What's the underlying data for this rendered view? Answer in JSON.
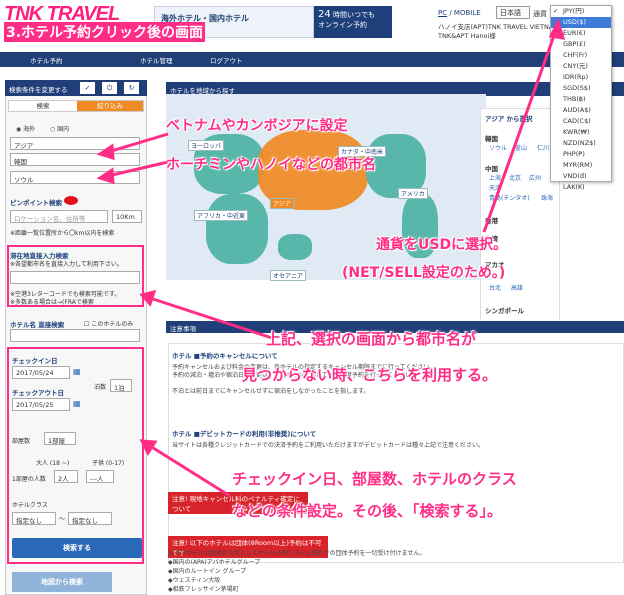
{
  "header": {
    "logo": "TNK TRAVEL",
    "banner_title": "海外ホテル・国内ホテル",
    "hours_big": "24",
    "hours_text": "時間いつでも",
    "hours_sub": "オンライン予約",
    "pc": "PC",
    "mobile": "MOBILE",
    "language": "日本語",
    "currency_label": "通貨",
    "address1": "ハノイ支店(APT)TNK TRAVEL VIETNAM",
    "address2": "TNK&APT Hanoi様"
  },
  "nav": [
    "ホテル予約",
    "ホテル管理",
    "ログアウト"
  ],
  "currency_menu": {
    "items": [
      "JPY(円)",
      "USD($)",
      "EUR(€)",
      "GBP(£)",
      "CHF(Fr)",
      "CNY(元)",
      "IDR(Rp)",
      "SGD(S$)",
      "THB(฿)",
      "AUD(A$)",
      "CAD(C$)",
      "KWR(₩)",
      "NZD(NZ$)",
      "PHP(₱)",
      "MYR(RM)",
      "VND(đ)",
      "LAK(₭)"
    ],
    "selected": "USD($)",
    "check": "✓"
  },
  "left": {
    "header": "検索条件を変更する",
    "tab_search": "検索",
    "tab_filter": "絞り込み",
    "radio_overseas": "海外",
    "radio_domestic": "国内",
    "region": "アジア",
    "country": "韓国",
    "city": "ソウル",
    "pinpoint": "ピンポイント検索",
    "location_placeholder": "ロケーション名、住所等",
    "distance": "10Km",
    "distance_note": "※距離一覧位置所から〇km以内を検索",
    "city_input_title": "滞在地直接入力検索",
    "city_input_note": "※各望都市名を直接入力して利用下さい。",
    "city_input_note2": "※空港3レターコードでも検索可能です。",
    "city_input_note3": "※多数ある場合は→(FRAで検索",
    "hotel_name_search": "ホテル名 直接検索",
    "hotel_only": "このホテルのみ",
    "checkin_label": "チェックイン日",
    "checkin": "2017/05/24",
    "checkout_label": "チェックアウト日",
    "checkout": "2017/05/25",
    "nights_label": "泊数",
    "nights": "1泊",
    "rooms_label": "部屋数",
    "rooms": "1部屋",
    "adults_label": "大人 (18 ~)",
    "children_label": "子供 (0-17)",
    "per_room": "1部屋の人数",
    "adults": "2人",
    "children": "---人",
    "class_label": "ホテルクラス",
    "class_from": "指定なし",
    "tilde": "〜",
    "class_to": "指定なし",
    "search_button": "検索する",
    "map_search": "地図から検索"
  },
  "map": {
    "header": "ホテルを地域から探す",
    "labels": [
      "ヨーロッパ",
      "カナダ・中南米",
      "アメリカ",
      "アフリカ・中近東",
      "アジア",
      "オセアニア"
    ],
    "right_header": "アジア から選択"
  },
  "asia_panel": {
    "items": [
      "韓国",
      "ソウル",
      "釜山",
      "仁川",
      "中国",
      "上海",
      "北京",
      "広州",
      "天津",
      "青島(チンタオ)",
      "珠海",
      "香港",
      "台湾",
      "マカオ",
      "台北",
      "高雄",
      "シンガポール"
    ]
  },
  "notices": {
    "header": "注意事項",
    "t1": "ホテル",
    "t1b": "■予約のキャンセルについて",
    "p1": "予約キャンセルおよび料金の変更は、各ホテルの指定するキャンセル期限までに行ってください。",
    "p2": "予約の減泊・増泊や宿泊日の変更は、一度キャンセルしてから再度予約を行ってください。",
    "p3": "不泊とは前日までにキャンセルせずに宿泊をしなかったことを指します。",
    "t2": "ホテル",
    "t2b": "■デビットカードの利用(非推奨)について",
    "p4": "当サイトは各種クレジットカードでの決済予約をご利用いただけますがデビットカードは種々上記で注意ください。",
    "bar1": "注意! 現地キャンセル料のペナルティ確定について",
    "bar2": "注意! 以下のホテルは団体(8Room以上)予約は不可です",
    "p5": "以下のホテルは団体の方針としてホテル予約システム操作での団体予約を一切受け付けません。",
    "list": [
      "◆国内の(APA)アパホテルグループ",
      "◆国内のルートイン グループ",
      "◆ウェスティン大阪",
      "◆相鉄フレッサイン茅場町"
    ]
  },
  "annotations": {
    "title": "3.ホテル予約クリック後の画面",
    "a1": "ベトナムやカンボジアに設定",
    "a2": "ホーチミンやハノイなどの都市名",
    "a3": "通貨をUSDに選択。",
    "a4": "(NET/SELL設定のため。)",
    "a5": "上記、選択の画面から都市名が",
    "a6": "見つからない時、こちらを利用する。",
    "a7": "チェックイン日、部屋数、ホテルのクラス",
    "a8": "などの条件設定。その後、「検索する」。"
  },
  "colors": {
    "accent": "#ff2d86",
    "navy": "#203f78",
    "land": "#58b7aa",
    "asia": "#f08a24"
  }
}
